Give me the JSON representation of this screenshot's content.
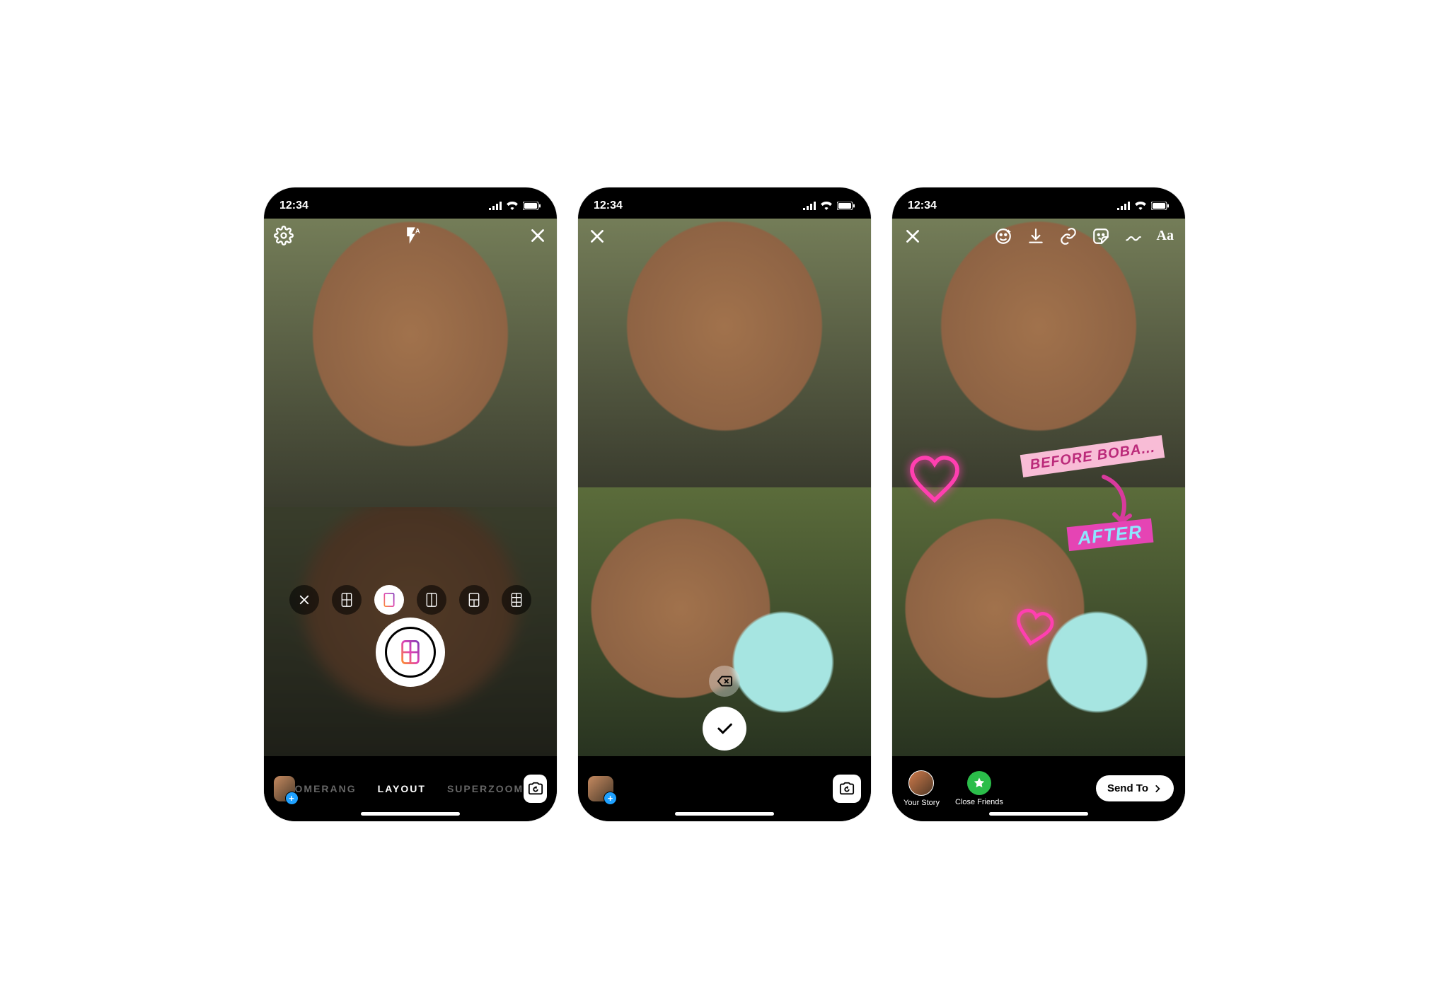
{
  "status": {
    "time": "12:34"
  },
  "screen1": {
    "modes": {
      "prev": "OMERANG",
      "active": "LAYOUT",
      "next": "SUPERZOOM"
    },
    "layout_options": [
      "close",
      "grid-1",
      "grid-2-v",
      "grid-2-h",
      "grid-1-2",
      "grid-3x2"
    ],
    "selected_layout_index": 2
  },
  "screen3": {
    "sticker_before": "BEFORE BOBA...",
    "sticker_after": "AFTER",
    "your_story": "Your Story",
    "close_friends": "Close Friends",
    "send_to": "Send To"
  }
}
